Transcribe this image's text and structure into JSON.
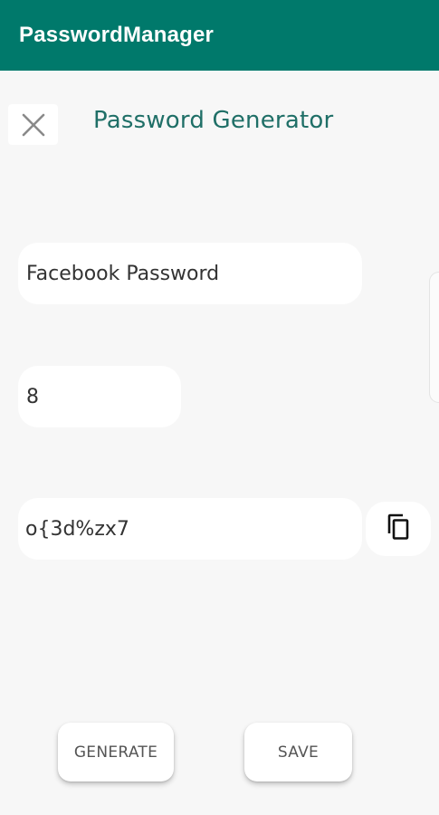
{
  "appbar": {
    "title": "PasswordManager",
    "color": "#00796b"
  },
  "screen": {
    "title": "Password Generator",
    "close_icon": "close-icon"
  },
  "form": {
    "name_value": "Facebook Password",
    "length_value": "8",
    "password_value": "o{3d%zx7",
    "copy_icon": "copy-icon"
  },
  "actions": {
    "generate_label": "GENERATE",
    "save_label": "SAVE"
  }
}
